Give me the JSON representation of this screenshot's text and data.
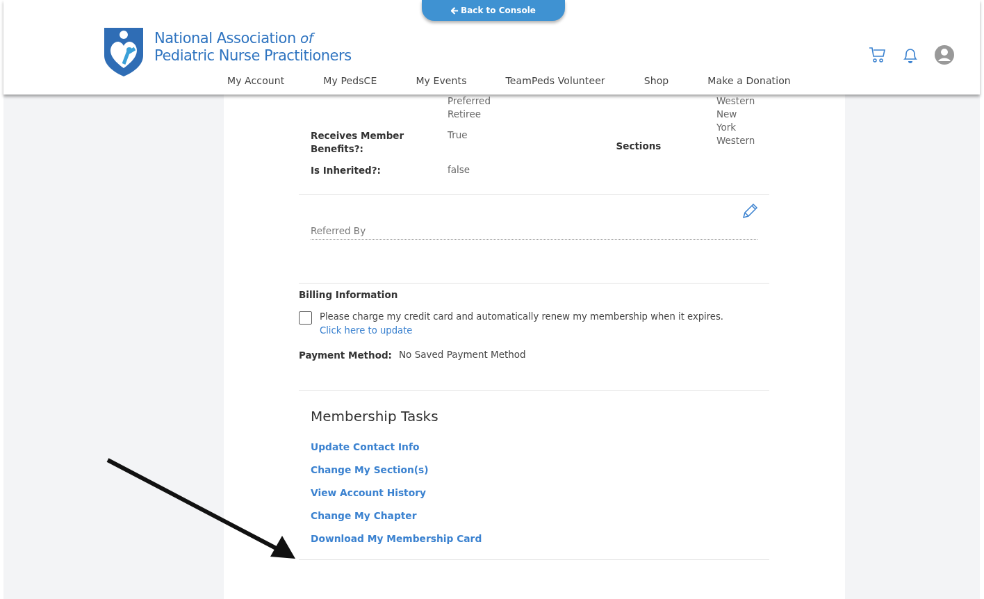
{
  "console_button": "Back to Console",
  "logo": {
    "line1": "National Association",
    "line1_italic": "of",
    "line2": "Pediatric Nurse Practitioners"
  },
  "nav": [
    "My Account",
    "My PedsCE",
    "My Events",
    "TeamPeds Volunteer",
    "Shop",
    "Make a Donation"
  ],
  "membership_types": [
    "Preferred",
    "Retiree"
  ],
  "chapters": [
    "Western",
    "New York",
    "Western"
  ],
  "fields": [
    {
      "label": "Receives Member Benefits?:",
      "value": "True"
    },
    {
      "label": "Is Inherited?:",
      "value": "false"
    }
  ],
  "sections_label": "Sections",
  "referred_by": {
    "placeholder": "Referred By"
  },
  "billing": {
    "title": "Billing Information",
    "auto_renew": {
      "checked": false,
      "label": "Please charge my credit card and automatically renew my membership when it expires.",
      "link": "Click here to update"
    },
    "payment_label": "Payment Method:",
    "payment_value": "No Saved Payment Method"
  },
  "tasks": {
    "title": "Membership Tasks",
    "links": [
      "Update Contact Info",
      "Change My Section(s)",
      "View Account History",
      "Change My Chapter",
      "Download My Membership Card"
    ]
  }
}
